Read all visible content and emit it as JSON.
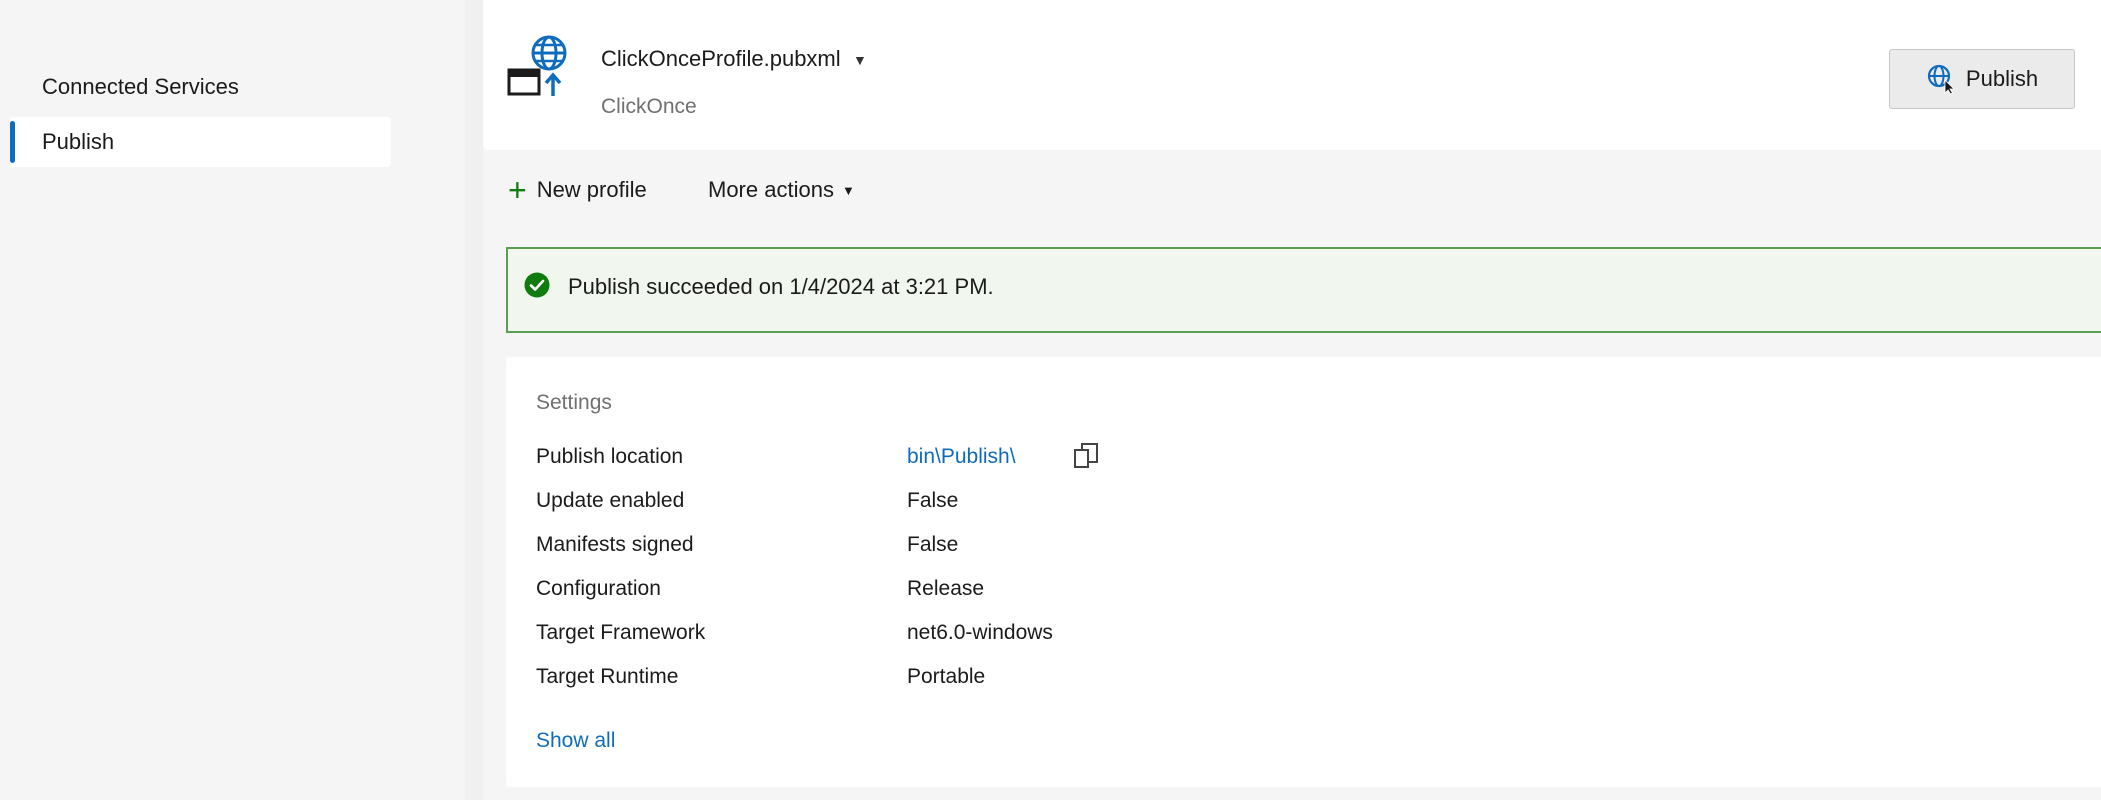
{
  "sidebar": {
    "items": [
      {
        "label": "Connected Services"
      },
      {
        "label": "Publish"
      }
    ]
  },
  "header": {
    "profile_name": "ClickOnceProfile.pubxml",
    "profile_type": "ClickOnce",
    "publish_button": "Publish"
  },
  "toolbar": {
    "new_profile": "New profile",
    "more_actions": "More actions"
  },
  "banner": {
    "message": "Publish succeeded on 1/4/2024 at 3:21 PM."
  },
  "settings": {
    "title": "Settings",
    "rows": [
      {
        "label": "Publish location",
        "value": "bin\\Publish\\"
      },
      {
        "label": "Update enabled",
        "value": "False"
      },
      {
        "label": "Manifests signed",
        "value": "False"
      },
      {
        "label": "Configuration",
        "value": "Release"
      },
      {
        "label": "Target Framework",
        "value": "net6.0-windows"
      },
      {
        "label": "Target Runtime",
        "value": "Portable"
      }
    ],
    "show_all": "Show all"
  },
  "colors": {
    "accent": "#0f6cbd",
    "success": "#107c10",
    "success_border": "#5a9e53"
  },
  "icons": [
    "publish-profile-icon",
    "publish-globe-icon",
    "plus-icon",
    "chevron-down-icon",
    "success-check-icon",
    "copy-icon"
  ]
}
